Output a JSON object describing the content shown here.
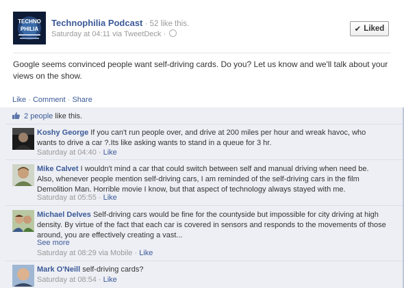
{
  "post": {
    "page_name": "Technophilia Podcast",
    "likes_text": "52 like this.",
    "timestamp": "Saturday at 04:11",
    "via": "via TweetDeck",
    "text": "Google seems convinced people want self-driving cards. Do you? Let us know and we'll talk about your views on the show.",
    "liked_label": "Liked",
    "logo_text": "TECHNO PHILIA"
  },
  "actions": {
    "like": "Like",
    "comment": "Comment",
    "share": "Share"
  },
  "likes_summary": {
    "people": "2 people",
    "suffix": "like this."
  },
  "comments": [
    {
      "author": "Koshy George",
      "text": "If you can't run people over, and drive at 200 miles per hour and wreak havoc, who wants to drive a car ?.Its like asking wants to stand in a queue for 3 hr.",
      "time": "Saturday at 04:40",
      "like": "Like"
    },
    {
      "author": "Mike Calvet",
      "text": "I wouldn't mind a car that could switch between self and manual driving when need be. Also, whenever people mention self-driving cars, I am reminded of the self-driving cars in the film Demolition Man. Horrible movie I know, but that aspect of technology always stayed with me.",
      "time": "Saturday at 05:55",
      "like": "Like"
    },
    {
      "author": "Michael Delves",
      "text": "Self-driving cars would be fine for the countyside but impossible for city driving at high density. By virtue of the fact that each car is covered in sensors and responds to the movements of those around, you are effectively creating a vast...",
      "see_more": "See more",
      "time": "Saturday at 08:29 via Mobile",
      "like": "Like"
    },
    {
      "author": "Mark O'Neill",
      "text": "self-driving cards?",
      "time": "Saturday at 08:54",
      "like": "Like"
    }
  ],
  "colors": {
    "link": "#3b5998",
    "feedback_bg": "#edeff4",
    "meta": "#999999"
  }
}
